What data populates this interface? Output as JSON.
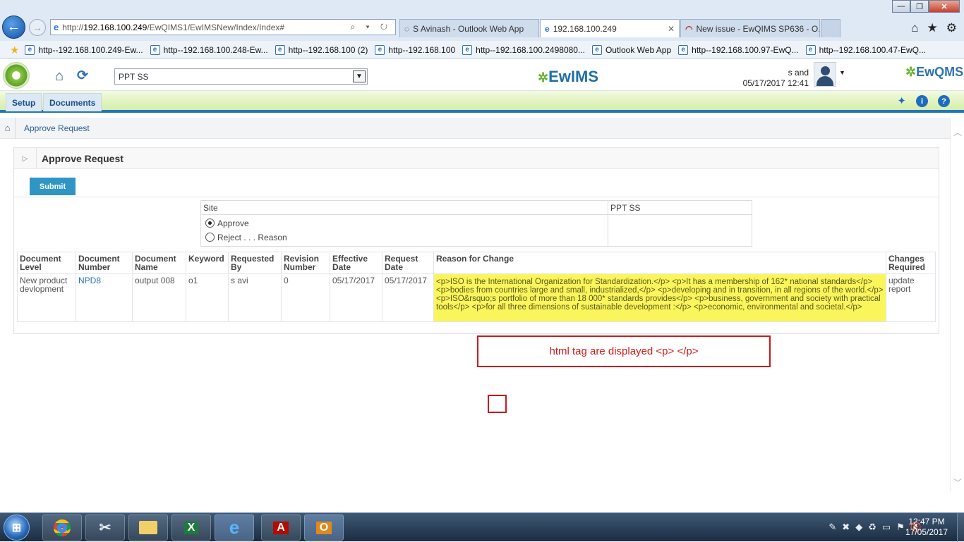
{
  "browser": {
    "address": {
      "scheme": "http://",
      "host": "192.168.100.249",
      "path": "/EwQIMS1/EwIMSNew/Index/Index#",
      "icons": "⌕ ▾ ↻"
    },
    "tabs": [
      {
        "title": "S Avinash - Outlook Web App",
        "icon": "loading-icon",
        "glyph": "◌"
      },
      {
        "title": "192.168.100.249",
        "icon": "ie-icon",
        "glyph": "e",
        "close": "✕"
      },
      {
        "title": "New issue - EwQIMS SP636 - O...",
        "icon": "redmine-icon",
        "glyph": "◠"
      }
    ],
    "right_icons": {
      "home": "⌂",
      "favorites": "★",
      "tools": "⚙"
    },
    "window_controls": {
      "minimize": "—",
      "maximize": "❐",
      "close": "✕"
    },
    "favorites": [
      "http--192.168.100.249-Ew...",
      "http--192.168.100.248-Ew...",
      "http--192.168.100 (2)",
      "http--192.168.100",
      "http--192.168.100.2498080...",
      "Outlook Web App",
      "http--192.168.100.97-EwQ...",
      "http--192.168.100.47-EwQ..."
    ]
  },
  "app": {
    "site_selected": "PPT SS",
    "logo_text": "EwIMS",
    "logo_text_right": "EwQMS",
    "user_name": "s and",
    "user_datetime": "05/17/2017 12:41"
  },
  "nav": {
    "tabs": [
      "Setup",
      "Documents"
    ]
  },
  "breadcrumb": {
    "current": "Approve Request"
  },
  "panel": {
    "title": "Approve Request",
    "submit_label": "Submit",
    "site_label": "Site",
    "site_value": "PPT SS",
    "approve_label": "Approve",
    "reject_label": "Reject . . . Reason",
    "approve_selected": true
  },
  "table": {
    "headers": [
      [
        "Document",
        "Level"
      ],
      [
        "Document",
        "Number"
      ],
      [
        "Document",
        "Name"
      ],
      [
        "Keyword",
        ""
      ],
      [
        "Requested",
        "By"
      ],
      [
        "Revision",
        "Number"
      ],
      [
        "Effective",
        "Date"
      ],
      [
        "Request",
        "Date"
      ],
      [
        "Reason for Change",
        ""
      ],
      [
        "Changes",
        "Required"
      ]
    ],
    "rows": [
      {
        "doc_level": "New product devlopment",
        "doc_number": "NPD8",
        "doc_name": "output 008",
        "keyword": "o1",
        "requested_by": "s avi",
        "revision": "0",
        "effective_date": "05/17/2017",
        "request_date": "05/17/2017",
        "reason": "<p>ISO is the International Organization for Standardization.</p> <p>It has a membership of 162* national standards</p> <p>bodies from countries large and small, industrialized,</p> <p>developing and in transition, in all regions of the world.</p> <p>ISO&rsquo;s portfolio of more than 18 000* standards provides</p> <p>business, government and society with practical tools</p> <p>for all three dimensions of sustainable development :</p> <p>economic, environmental and societal.</p>",
        "changes_required": "update report"
      }
    ]
  },
  "annotation": {
    "text": "html tag are displayed <p> </p>"
  },
  "taskbar": {
    "apps": [
      "chrome-icon",
      "snipping-icon",
      "folder-icon",
      "excel-icon",
      "ie-icon",
      "acrobat-icon",
      "outlook-icon"
    ],
    "clock_time": "12:47 PM",
    "clock_date": "17/05/2017"
  },
  "colors": {
    "highlight": "#fbf55c",
    "annotation": "#c81a1a",
    "submit": "#2f95c4",
    "nav_border": "#2574b8"
  }
}
